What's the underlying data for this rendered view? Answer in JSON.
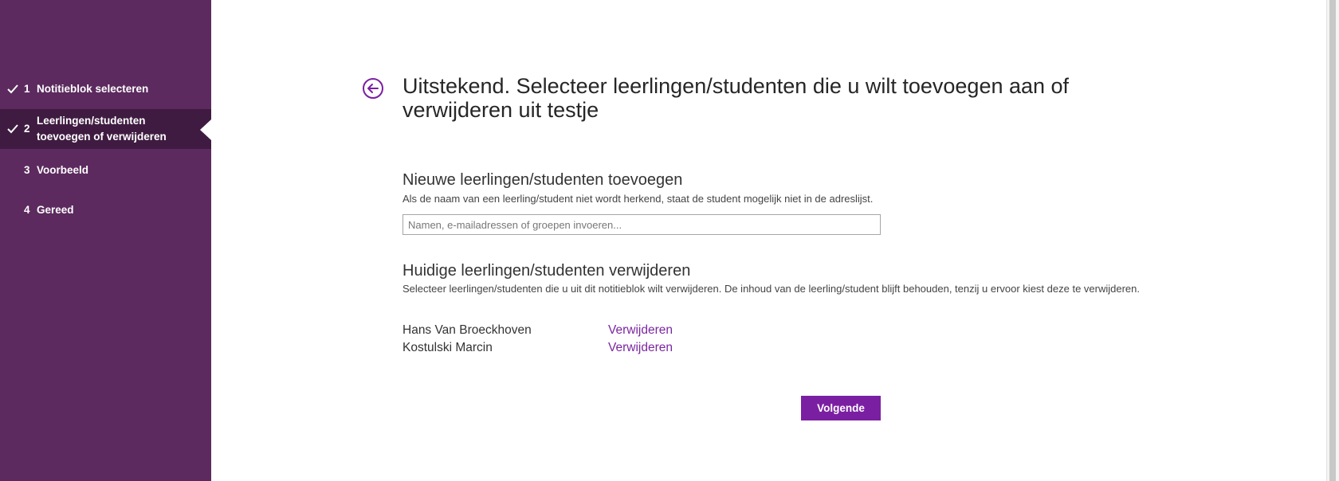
{
  "sidebar": {
    "steps": [
      {
        "number": "1",
        "label": "Notitieblok selecteren",
        "completed": true
      },
      {
        "number": "2",
        "label": "Leerlingen/studenten toevoegen of verwijderen",
        "completed": true,
        "active": true
      },
      {
        "number": "3",
        "label": "Voorbeeld",
        "completed": false
      },
      {
        "number": "4",
        "label": "Gereed",
        "completed": false
      }
    ]
  },
  "main": {
    "title": "Uitstekend. Selecteer leerlingen/studenten die u wilt toevoegen aan of verwijderen uit testje",
    "add_section": {
      "title": "Nieuwe leerlingen/studenten toevoegen",
      "description": "Als de naam van een leerling/student niet wordt herkend, staat de student mogelijk niet in de adreslijst.",
      "input_value": "",
      "input_placeholder": "Namen, e-mailadressen of groepen invoeren..."
    },
    "remove_section": {
      "title": "Huidige leerlingen/studenten verwijderen",
      "description": "Selecteer leerlingen/studenten die u uit dit notitieblok wilt verwijderen. De inhoud van de leerling/student blijft behouden, tenzij u ervoor kiest deze te verwijderen.",
      "students": [
        {
          "name": "Hans Van Broeckhoven",
          "action": "Verwijderen"
        },
        {
          "name": "Kostulski Marcin",
          "action": "Verwijderen"
        }
      ]
    },
    "next_button": "Volgende"
  },
  "colors": {
    "sidebar_bg": "#5c2a5e",
    "sidebar_active_bg": "#3f1b41",
    "accent": "#7b1fa2",
    "link": "#7b26a1"
  },
  "icons": {
    "back": "back-arrow-circle-icon",
    "check": "check-icon"
  }
}
